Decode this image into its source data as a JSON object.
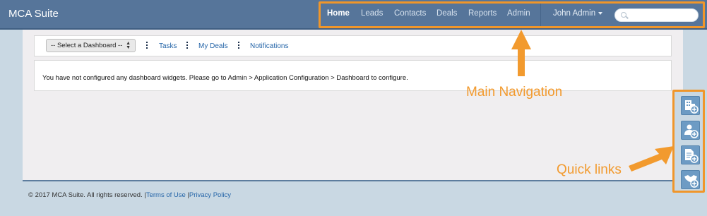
{
  "app": {
    "brand": "MCA Suite"
  },
  "nav": {
    "items": [
      {
        "label": "Home",
        "active": true
      },
      {
        "label": "Leads"
      },
      {
        "label": "Contacts"
      },
      {
        "label": "Deals"
      },
      {
        "label": "Reports"
      },
      {
        "label": "Admin"
      }
    ],
    "user": "John Admin",
    "search": {
      "placeholder": "",
      "value": ""
    }
  },
  "toolbar": {
    "dashboard_select": "-- Select a Dashboard --",
    "links": [
      "Tasks",
      "My Deals",
      "Notifications"
    ]
  },
  "content": {
    "message": "You have not configured any dashboard widgets. Please go to Admin > Application Configuration > Dashboard to configure."
  },
  "footer": {
    "copyright": "© 2017 MCA Suite. All rights reserved.",
    "separator": "|",
    "terms": "Terms of Use",
    "privacy": "Privacy Policy"
  },
  "annotations": {
    "main_navigation": "Main Navigation",
    "quick_links": "Quick links",
    "color": "#f29a2e"
  },
  "quick_links": [
    "add-company-icon",
    "add-contact-icon",
    "add-document-icon",
    "add-deal-icon"
  ]
}
